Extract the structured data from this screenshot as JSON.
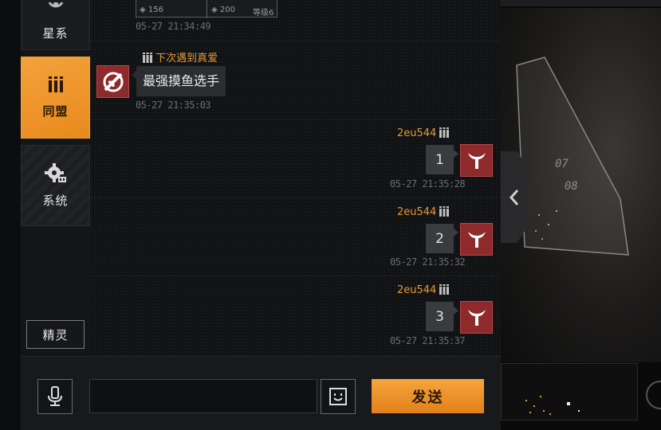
{
  "nav": {
    "galaxy_label": "星系",
    "alliance_label": "同盟",
    "system_label": "系统",
    "sprite_label": "精灵"
  },
  "messages": [
    {
      "side": "left",
      "card": {
        "item1": "156",
        "item2": "200",
        "level": "等级6"
      },
      "time": "05-27 21:34:49"
    },
    {
      "side": "left",
      "sender": "下次遇到真爱",
      "text": "最强摸鱼选手",
      "time": "05-27 21:35:03"
    },
    {
      "side": "right",
      "sender": "2eu544",
      "text": "1",
      "time": "05-27 21:35:28"
    },
    {
      "side": "right",
      "sender": "2eu544",
      "text": "2",
      "time": "05-27 21:35:32"
    },
    {
      "side": "right",
      "sender": "2eu544",
      "text": "3",
      "time": "05-27 21:35:37"
    }
  ],
  "input": {
    "value": "",
    "placeholder": "",
    "send_label": "发送"
  },
  "map": {
    "sector_a": "07",
    "sector_b": "08"
  },
  "colors": {
    "accent": "#f0a03a",
    "sender_name": "#e39a3a",
    "avatar_red": "#8e2a2c"
  }
}
